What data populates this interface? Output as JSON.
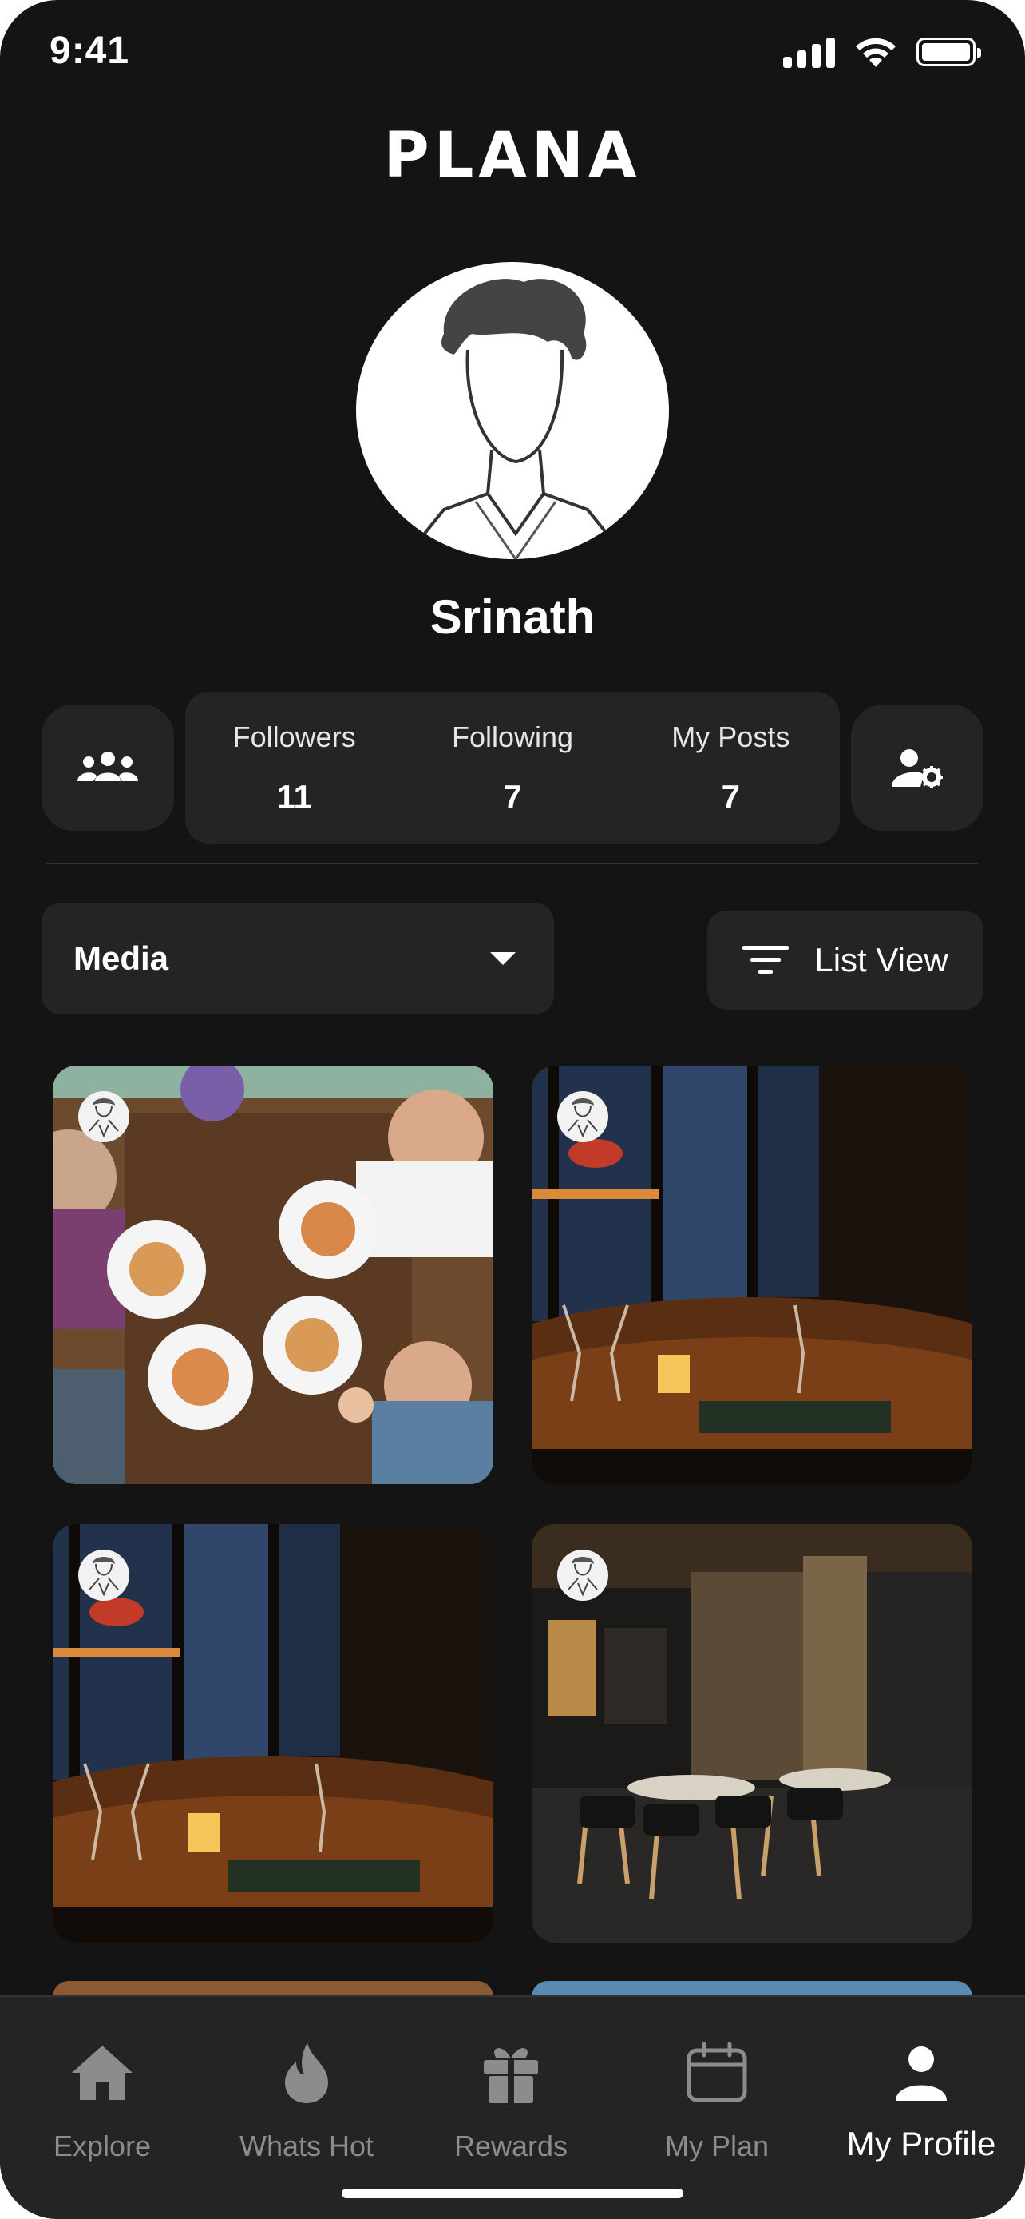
{
  "status_bar": {
    "time": "9:41"
  },
  "app": {
    "logo": "PLANA"
  },
  "profile": {
    "name": "Srinath",
    "stats": [
      {
        "label": "Followers",
        "value": "11"
      },
      {
        "label": "Following",
        "value": "7"
      },
      {
        "label": "My Posts",
        "value": "7"
      }
    ]
  },
  "filters": {
    "media_select": "Media",
    "view_toggle": "List View"
  },
  "tabbar": {
    "items": [
      {
        "label": "Explore",
        "icon": "home-icon"
      },
      {
        "label": "Whats Hot",
        "icon": "flame-icon"
      },
      {
        "label": "Rewards",
        "icon": "gift-icon"
      },
      {
        "label": "My Plan",
        "icon": "calendar-icon"
      },
      {
        "label": "My Profile",
        "icon": "person-icon",
        "active": true
      }
    ]
  },
  "colors": {
    "background": "#141414",
    "card": "#242424",
    "text": "#ffffff",
    "muted": "#8c8c8c"
  }
}
